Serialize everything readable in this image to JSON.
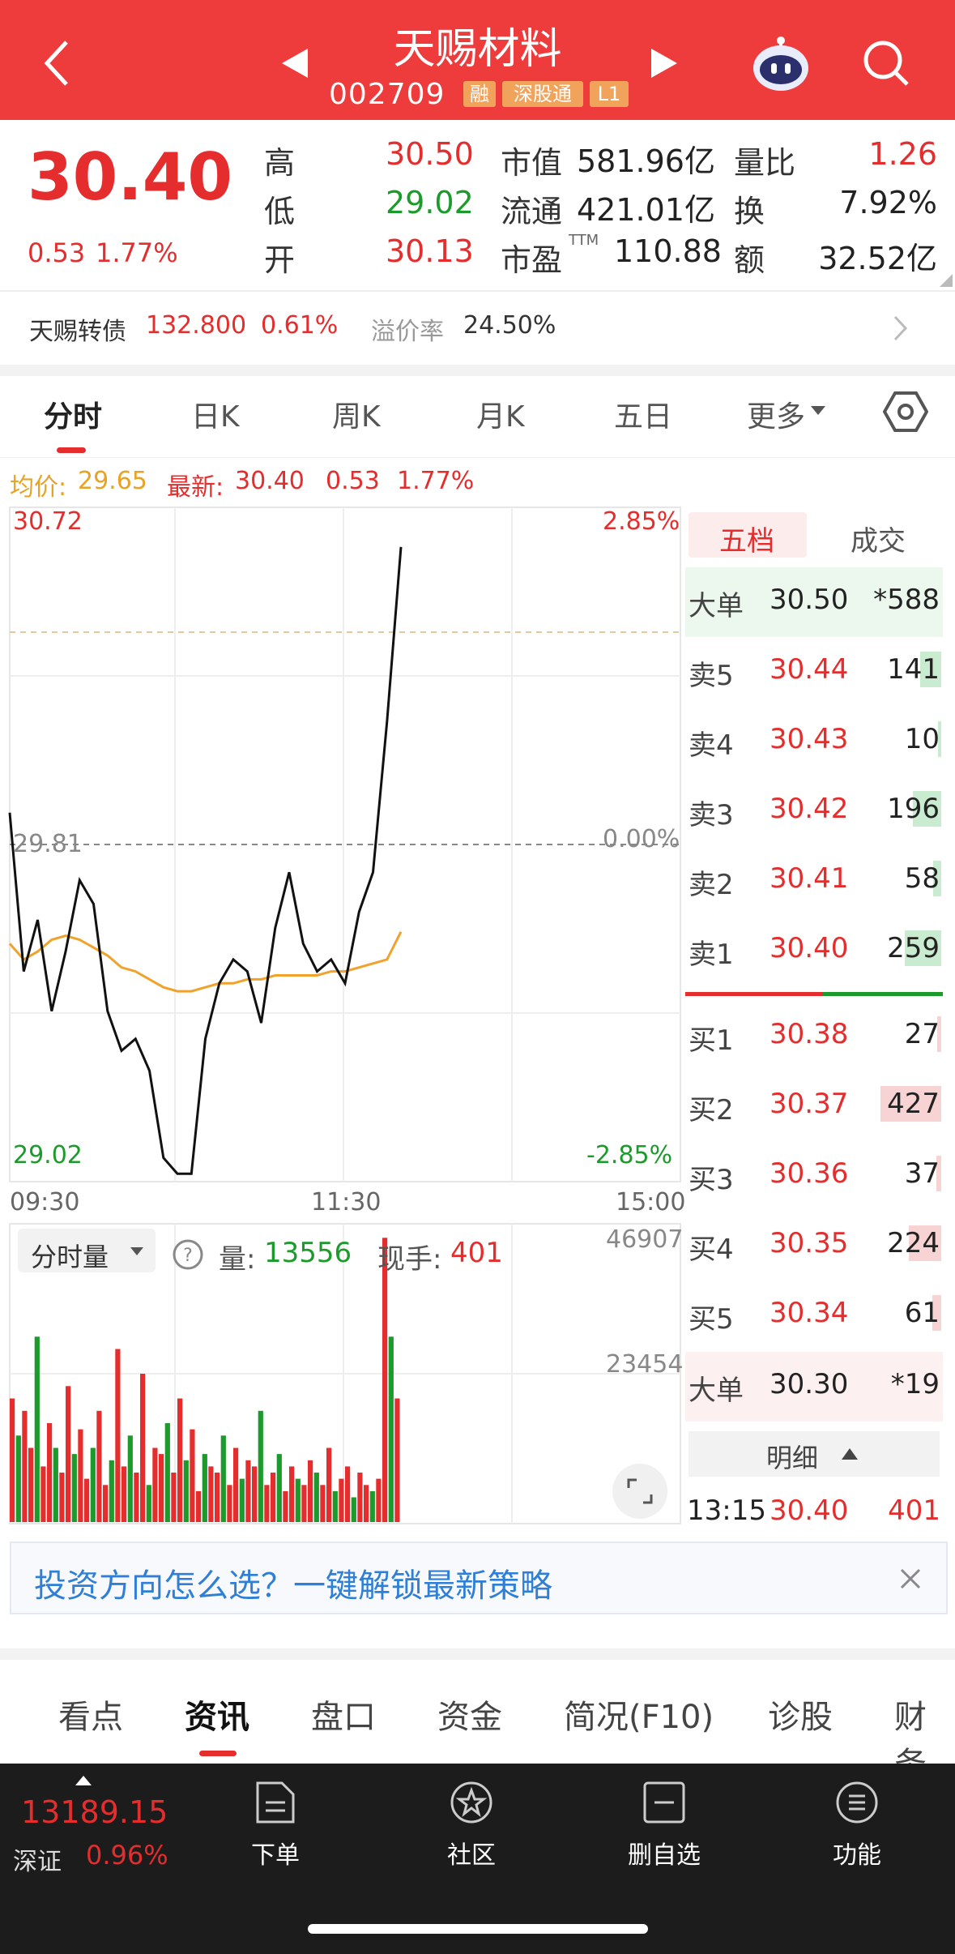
{
  "header": {
    "title": "天赐材料",
    "code": "002709",
    "tags": [
      "融",
      "深股通",
      "L1"
    ]
  },
  "quote": {
    "price": "30.40",
    "change": "0.53",
    "change_pct": "1.77%",
    "high_label": "高",
    "high": "30.50",
    "low_label": "低",
    "low": "29.02",
    "open_label": "开",
    "open": "30.13",
    "mcap_label": "市值",
    "mcap": "581.96亿",
    "float_label": "流通",
    "float": "421.01亿",
    "pe_label": "市盈",
    "pe_sup": "TTM",
    "pe": "110.88",
    "vr_label": "量比",
    "vr": "1.26",
    "turnover_label": "换",
    "turnover": "7.92%",
    "amount_label": "额",
    "amount": "32.52亿"
  },
  "bond": {
    "name": "天赐转债",
    "price": "132.800",
    "pct": "0.61%",
    "premium_label": "溢价率",
    "premium": "24.50%"
  },
  "chart_tabs": [
    "分时",
    "日K",
    "周K",
    "月K",
    "五日",
    "更多"
  ],
  "info_line": {
    "avg_label": "均价:",
    "avg": "29.65",
    "latest_label": "最新:",
    "latest": "30.40",
    "chg": "0.53",
    "pct": "1.77%"
  },
  "chart_labels": {
    "top_price": "30.72",
    "mid_price": "29.81",
    "bottom_price": "29.02",
    "top_pct": "2.85%",
    "mid_pct": "0.00%",
    "bottom_pct": "-2.85%",
    "t0": "09:30",
    "t1": "11:30",
    "t2": "15:00",
    "vol_max": "46907",
    "vol_mid": "23454"
  },
  "chart_data": {
    "type": "line",
    "x": [
      "09:30",
      "09:35",
      "09:40",
      "09:45",
      "09:50",
      "09:55",
      "10:00",
      "10:05",
      "10:10",
      "10:15",
      "10:20",
      "10:25",
      "10:30",
      "10:35",
      "10:40",
      "10:45",
      "10:50",
      "10:55",
      "11:00",
      "11:05",
      "11:10",
      "11:15",
      "11:20",
      "11:25",
      "11:30",
      "13:00",
      "13:05",
      "13:10",
      "13:15"
    ],
    "series": [
      {
        "values": [
          29.95,
          29.55,
          29.68,
          29.45,
          29.6,
          29.78,
          29.72,
          29.45,
          29.35,
          29.38,
          29.3,
          29.08,
          29.04,
          29.04,
          29.38,
          29.52,
          29.58,
          29.55,
          29.42,
          29.66,
          29.8,
          29.62,
          29.55,
          29.58,
          29.52,
          29.7,
          29.8,
          30.18,
          30.62
        ]
      },
      {
        "values": [
          29.62,
          29.58,
          29.6,
          29.63,
          29.64,
          29.63,
          29.61,
          29.59,
          29.56,
          29.55,
          29.53,
          29.51,
          29.5,
          29.5,
          29.51,
          29.52,
          29.52,
          29.53,
          29.53,
          29.54,
          29.54,
          29.54,
          29.54,
          29.55,
          29.55,
          29.56,
          29.57,
          29.58,
          29.65
        ]
      }
    ],
    "volume": [
      20,
      14,
      18,
      12,
      30,
      9,
      16,
      12,
      8,
      22,
      11,
      15,
      7,
      12,
      18,
      6,
      10,
      28,
      9,
      14,
      8,
      24,
      6,
      12,
      11,
      16,
      8,
      20,
      10,
      15,
      5,
      11,
      9,
      8,
      14,
      6,
      12,
      7,
      10,
      9,
      18,
      6,
      8,
      11,
      5,
      9,
      7,
      6,
      10,
      8,
      6,
      12,
      5,
      7,
      9,
      4,
      8,
      6,
      5,
      7,
      46,
      30,
      20
    ],
    "ylim": [
      29.02,
      30.72
    ],
    "vol_max": 46907
  },
  "volume_bar": {
    "menu": "分时量",
    "qty_label": "量:",
    "qty": "13556",
    "hand_label": "现手:",
    "hand": "401"
  },
  "orderbook": {
    "tab_active": "五档",
    "tab_other": "成交",
    "big_sell": {
      "label": "大单",
      "price": "30.50",
      "vol": "*588"
    },
    "asks": [
      {
        "label": "卖5",
        "price": "30.44",
        "vol": "141",
        "bar": 0.16
      },
      {
        "label": "卖4",
        "price": "30.43",
        "vol": "10",
        "bar": 0.02
      },
      {
        "label": "卖3",
        "price": "30.42",
        "vol": "196",
        "bar": 0.22
      },
      {
        "label": "卖2",
        "price": "30.41",
        "vol": "58",
        "bar": 0.06
      },
      {
        "label": "卖1",
        "price": "30.40",
        "vol": "259",
        "bar": 0.28
      }
    ],
    "bids": [
      {
        "label": "买1",
        "price": "30.38",
        "vol": "27",
        "bar": 0.03
      },
      {
        "label": "买2",
        "price": "30.37",
        "vol": "427",
        "bar": 0.47
      },
      {
        "label": "买3",
        "price": "30.36",
        "vol": "37",
        "bar": 0.04
      },
      {
        "label": "买4",
        "price": "30.35",
        "vol": "224",
        "bar": 0.25
      },
      {
        "label": "买5",
        "price": "30.34",
        "vol": "61",
        "bar": 0.07
      }
    ],
    "big_buy": {
      "label": "大单",
      "price": "30.30",
      "vol": "*19"
    },
    "detail_label": "明细",
    "tick": {
      "time": "13:15",
      "price": "30.40",
      "vol": "401"
    }
  },
  "banner": "投资方向怎么选？一键解锁最新策略",
  "bottom_tabs": [
    "看点",
    "资讯",
    "盘口",
    "资金",
    "简况(F10)",
    "诊股",
    "财务"
  ],
  "nav": {
    "index_value": "13189.15",
    "index_name": "深证",
    "index_pct": "0.96%",
    "items": [
      "下单",
      "社区",
      "删自选",
      "功能"
    ]
  },
  "colors": {
    "red": "#e52d2d",
    "green": "#1c9b2c",
    "header": "#ee3b3b"
  }
}
